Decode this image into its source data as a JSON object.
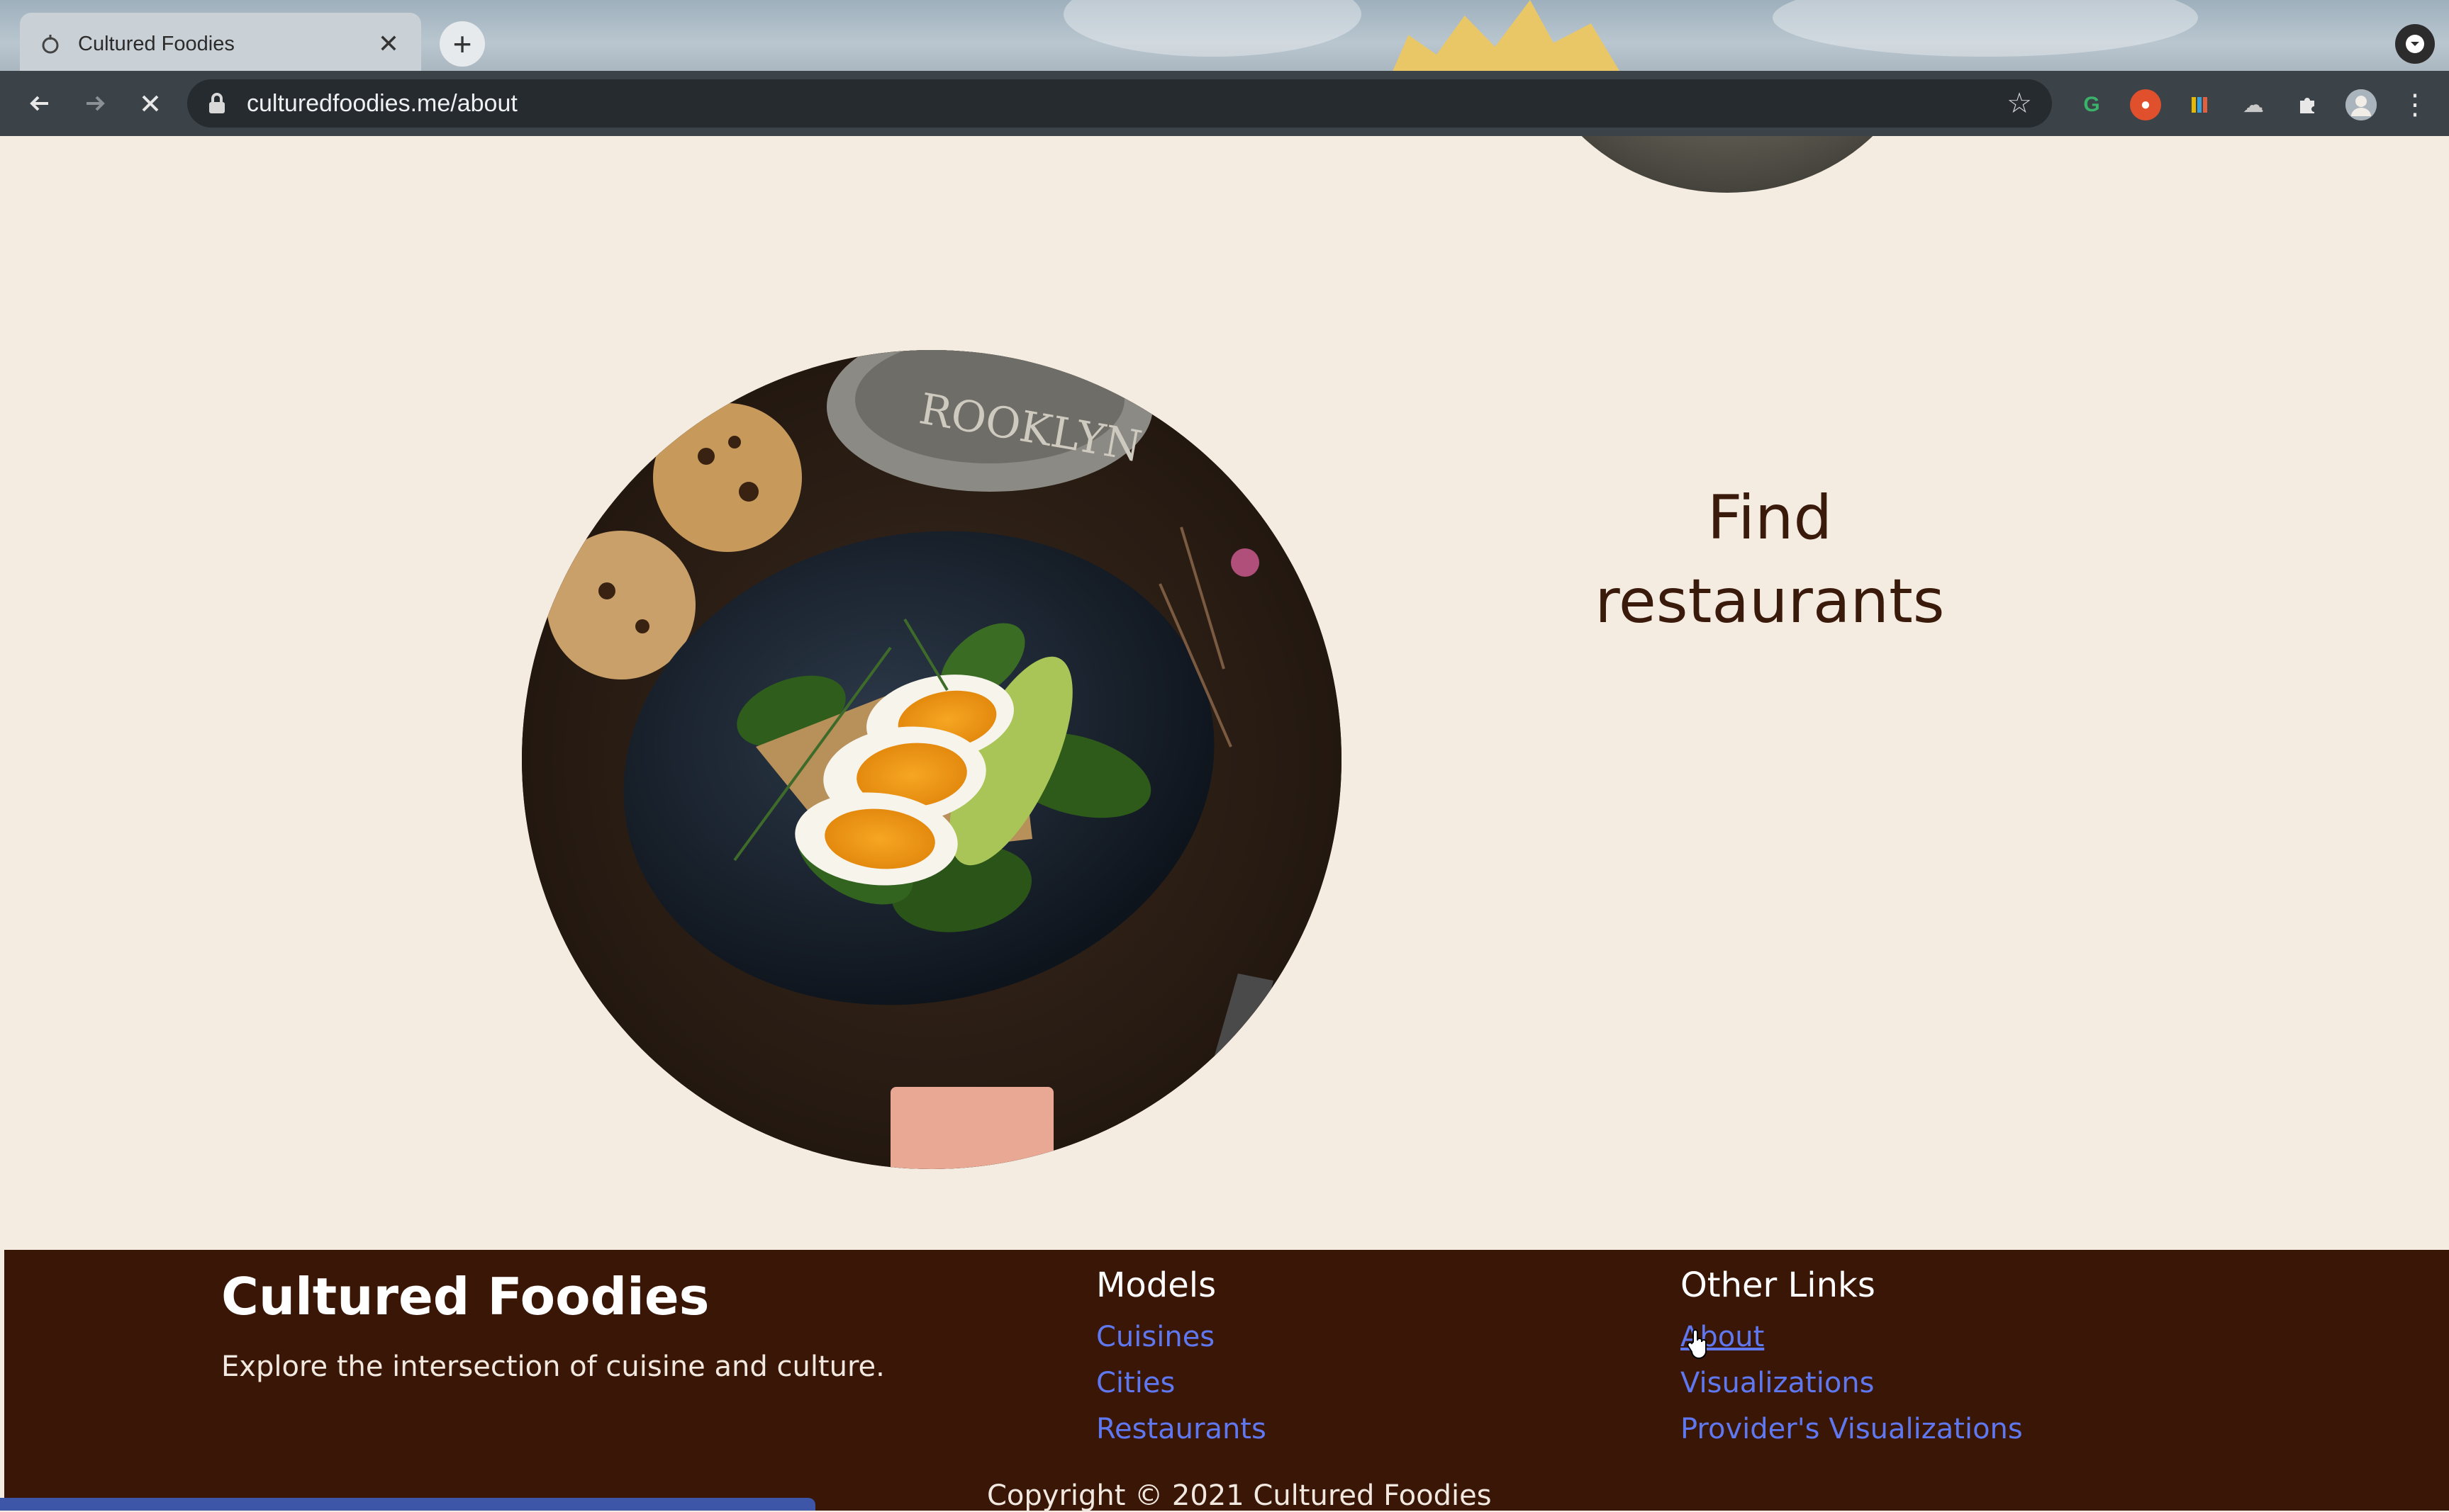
{
  "browser": {
    "tab": {
      "title": "Cultured Foodies",
      "favicon_icon": "site-favicon-icon",
      "close_icon": "close-icon"
    },
    "new_tab_icon": "plus-icon",
    "profile_dropdown_icon": "chevron-down-icon",
    "nav": {
      "back_icon": "back-arrow-icon",
      "forward_icon": "forward-arrow-icon",
      "stop_icon": "stop-loading-icon"
    },
    "address_bar": {
      "url": "culturedfoodies.me/about",
      "lock_icon": "lock-icon",
      "bookmark_icon": "star-icon"
    },
    "extensions": [
      "grammarly-icon",
      "red-shield-extension-icon",
      "colorful-extension-icon",
      "cloud-extension-icon",
      "puzzle-extensions-icon",
      "profile-avatar-icon",
      "kebab-menu-icon"
    ]
  },
  "section": {
    "heading_line1": "Find",
    "heading_line2": "restaurants",
    "image_icon": "food-plate-photo"
  },
  "footer": {
    "brand": "Cultured Foodies",
    "tagline": "Explore the intersection of cuisine and culture.",
    "models": {
      "title": "Models",
      "links": [
        "Cuisines",
        "Cities",
        "Restaurants"
      ]
    },
    "other_links": {
      "title": "Other Links",
      "links": [
        "About",
        "Visualizations",
        "Provider's Visualizations"
      ]
    },
    "copyright": "Copyright © 2021 Cultured Foodies"
  },
  "colors": {
    "page_bg": "#f4ebe1",
    "footer_bg": "#3a1607",
    "link": "#5f78f0",
    "heading": "#3a1b0b"
  }
}
